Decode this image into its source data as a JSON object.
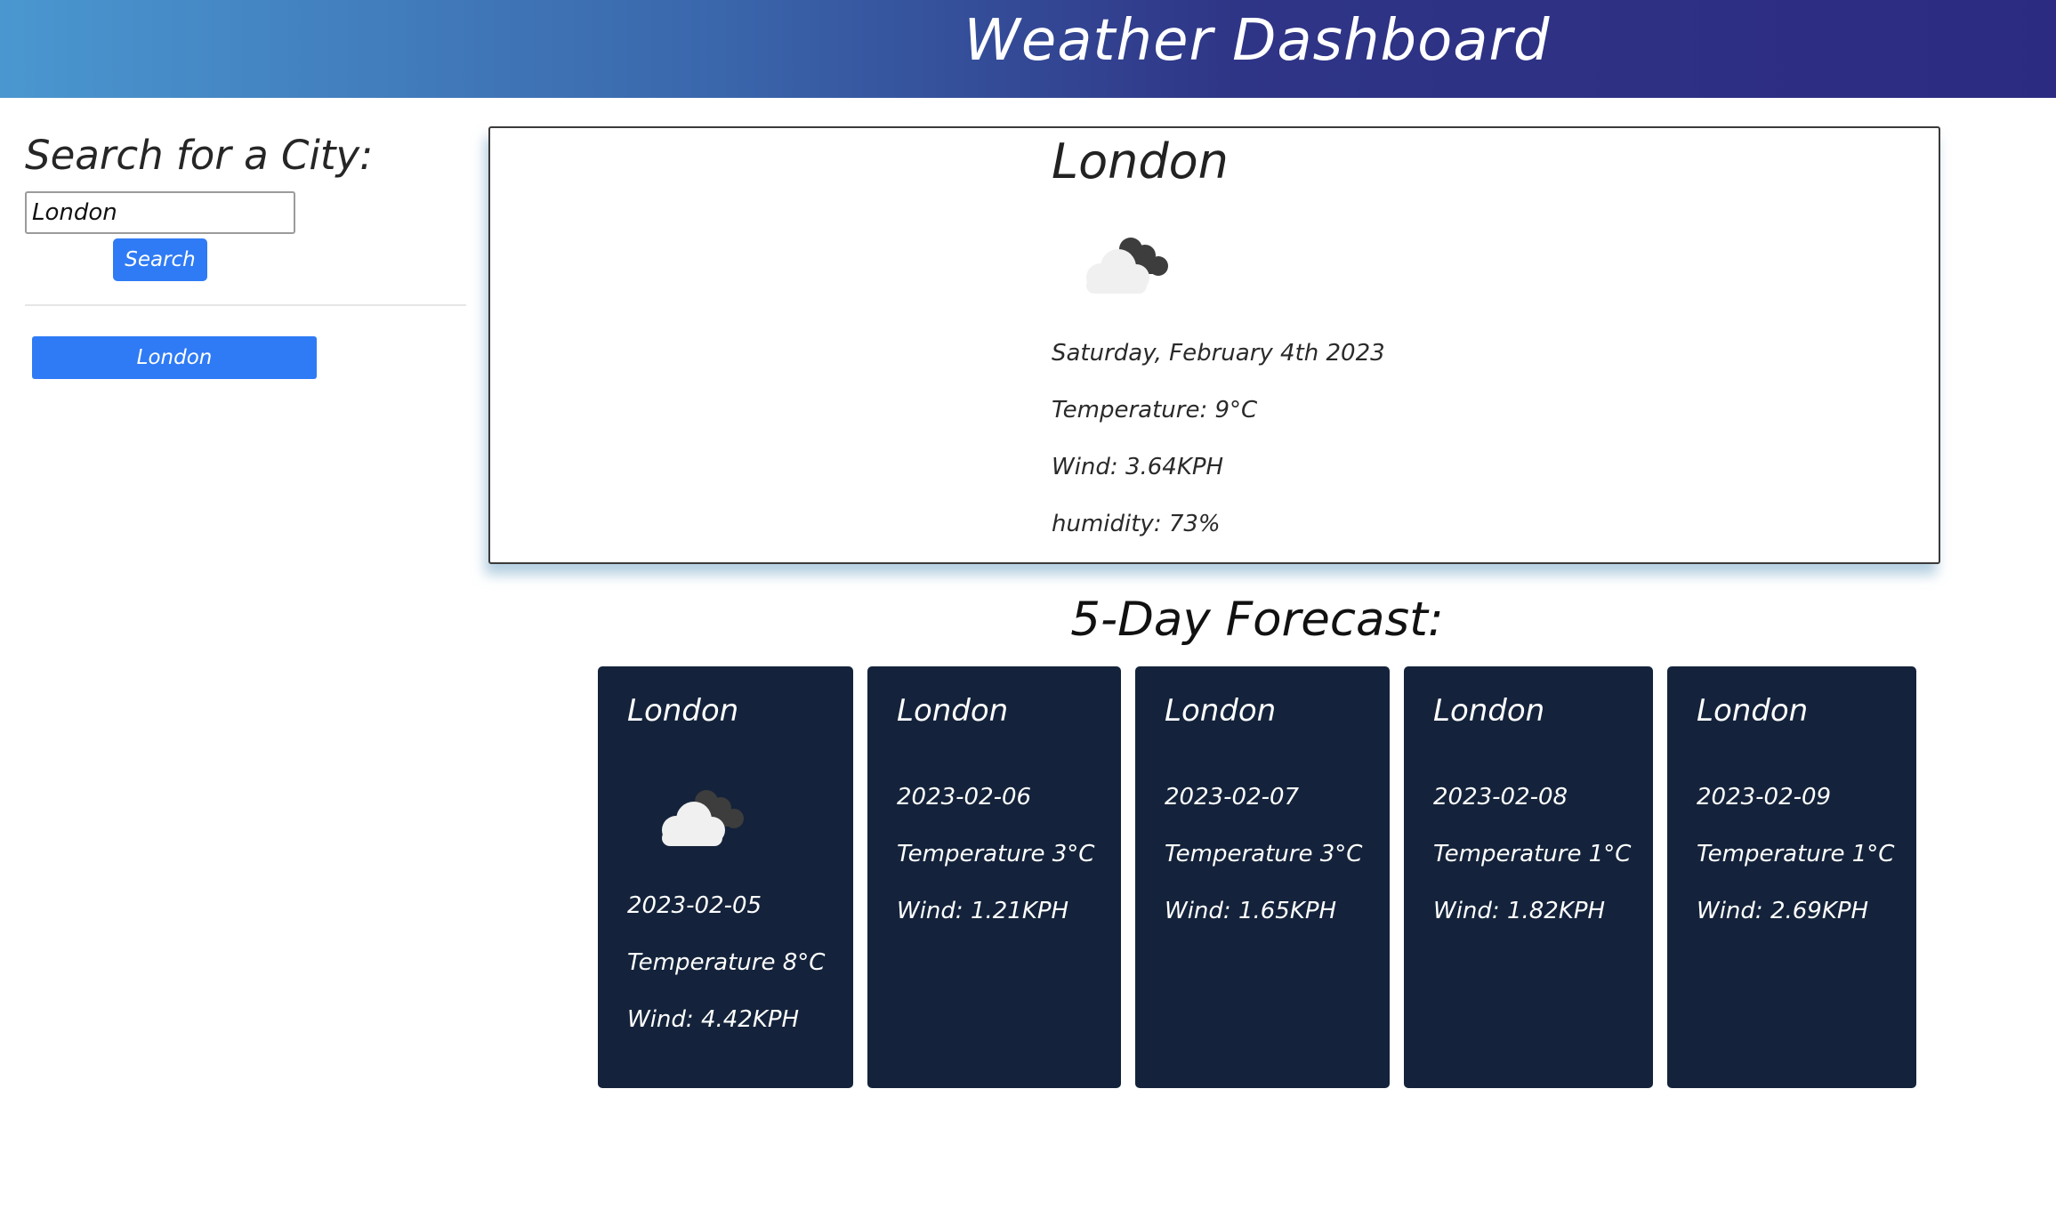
{
  "header": {
    "title": "Weather Dashboard"
  },
  "sidebar": {
    "heading": "Search for a City:",
    "search_value": "London",
    "search_button": "Search",
    "history": [
      "London"
    ]
  },
  "current": {
    "city": "London",
    "icon": "cloud-icon",
    "date": "Saturday, February 4th 2023",
    "temperature": "Temperature: 9°C",
    "wind": "Wind: 3.64KPH",
    "humidity": "humidity: 73%"
  },
  "forecast": {
    "heading": "5-Day Forecast:",
    "days": [
      {
        "city": "London",
        "icon": "cloud-icon",
        "date": "2023-02-05",
        "temperature": "Temperature 8°C",
        "wind": "Wind: 4.42KPH"
      },
      {
        "city": "London",
        "date": "2023-02-06",
        "temperature": "Temperature 3°C",
        "wind": "Wind: 1.21KPH"
      },
      {
        "city": "London",
        "date": "2023-02-07",
        "temperature": "Temperature 3°C",
        "wind": "Wind: 1.65KPH"
      },
      {
        "city": "London",
        "date": "2023-02-08",
        "temperature": "Temperature 1°C",
        "wind": "Wind: 1.82KPH"
      },
      {
        "city": "London",
        "date": "2023-02-09",
        "temperature": "Temperature 1°C",
        "wind": "Wind: 2.69KPH"
      }
    ]
  },
  "colors": {
    "accent": "#2f7bf5",
    "forecast_card": "#14233b",
    "header_start": "#4a97d0",
    "header_end": "#2c2b82"
  }
}
